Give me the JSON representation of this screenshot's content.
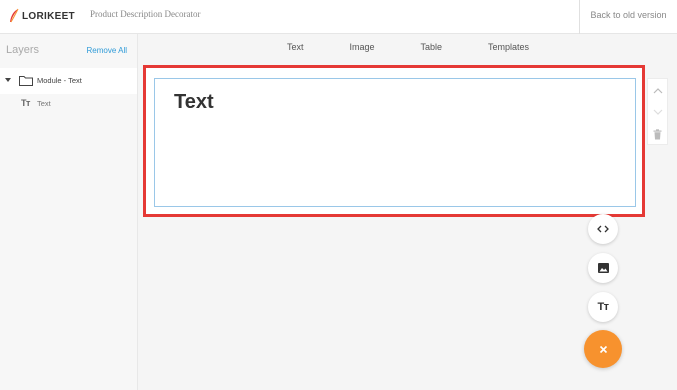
{
  "header": {
    "logo_text": "LORIKEET",
    "app_title": "Product Description Decorator",
    "back_link": "Back to old version"
  },
  "layers": {
    "title": "Layers",
    "remove_all": "Remove All",
    "items": [
      {
        "label": "Module - Text"
      },
      {
        "label": "Text"
      }
    ]
  },
  "toolbar": {
    "tabs": [
      "Text",
      "Image",
      "Table",
      "Templates"
    ]
  },
  "canvas": {
    "text_content": "Text"
  },
  "colors": {
    "accent_blue": "#2f9bd8",
    "selection_red": "#e53935",
    "fab_orange": "#f7922e"
  },
  "icons": {
    "side_tools": [
      "chevron-up-icon",
      "chevron-down-icon",
      "trash-icon"
    ],
    "fabs": [
      "code-icon",
      "image-icon",
      "text-icon",
      "close-icon"
    ]
  }
}
